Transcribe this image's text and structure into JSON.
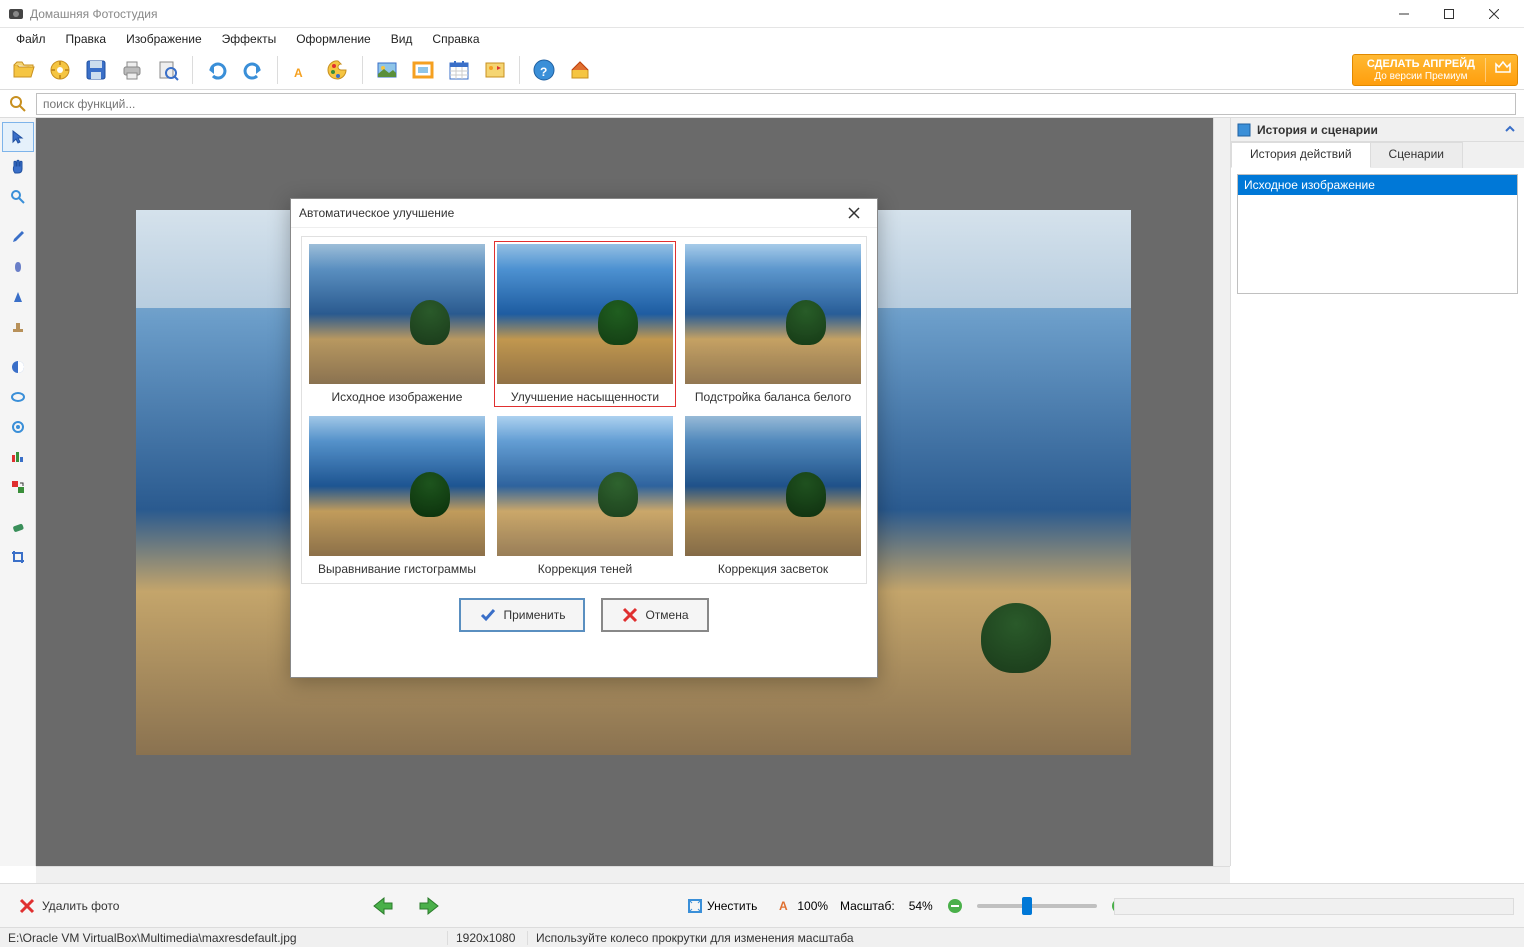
{
  "window": {
    "title": "Домашняя Фотостудия"
  },
  "menu": {
    "items": [
      "Файл",
      "Правка",
      "Изображение",
      "Эффекты",
      "Оформление",
      "Вид",
      "Справка"
    ]
  },
  "upgrade": {
    "line1": "СДЕЛАТЬ АПГРЕЙД",
    "line2": "До версии Премиум"
  },
  "search": {
    "placeholder": "поиск функций..."
  },
  "right_panel": {
    "title": "История и сценарии",
    "tabs": [
      "История действий",
      "Сценарии"
    ],
    "history_item": "Исходное изображение"
  },
  "dialog": {
    "title": "Автоматическое улучшение",
    "thumbs": [
      {
        "label": "Исходное изображение",
        "cls": ""
      },
      {
        "label": "Улучшение насыщенности",
        "cls": "sat",
        "selected": true
      },
      {
        "label": "Подстройка баланса белого",
        "cls": "wb"
      },
      {
        "label": "Выравнивание гистограммы",
        "cls": "hist"
      },
      {
        "label": "Коррекция теней",
        "cls": "shadow"
      },
      {
        "label": "Коррекция засветок",
        "cls": "highlight"
      }
    ],
    "apply": "Применить",
    "cancel": "Отмена"
  },
  "bottom": {
    "delete": "Удалить фото",
    "fit": "Унестить",
    "hundred": "100%",
    "scale_label": "Масштаб:",
    "scale_value": "54%"
  },
  "status": {
    "path": "E:\\Oracle VM VirtualBox\\Multimedia\\maxresdefault.jpg",
    "dims": "1920x1080",
    "hint": "Используйте колесо прокрутки для изменения масштаба"
  }
}
